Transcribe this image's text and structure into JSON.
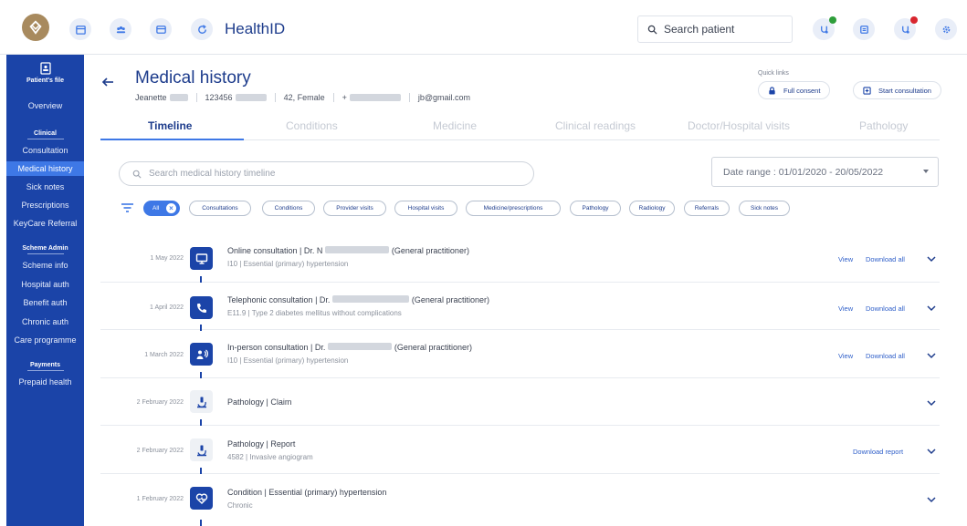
{
  "app": {
    "title": "HealthID"
  },
  "topbar": {
    "search_text": "Search patient"
  },
  "sidebar": {
    "file_label": "Patient's file",
    "overview": "Overview",
    "clinical_heading": "Clinical",
    "clinical_items": [
      "Consultation",
      "Medical history",
      "Sick notes",
      "Prescriptions",
      "KeyCare Referral"
    ],
    "scheme_heading": "Scheme Admin",
    "scheme_items": [
      "Scheme info",
      "Hospital auth",
      "Benefit auth",
      "Chronic auth",
      "Care programme"
    ],
    "payments_heading": "Payments",
    "payments_items": [
      "Prepaid health"
    ],
    "active_item": "Medical history"
  },
  "header": {
    "title": "Medical history",
    "patient_name": "Jeanette",
    "patient_id": "123456",
    "age_gender": "42, Female",
    "phone_prefix": "+",
    "email": "jb@gmail.com",
    "quick_links_label": "Quick links",
    "full_consent": "Full consent",
    "start_consultation": "Start consultation"
  },
  "tabs": [
    "Timeline",
    "Conditions",
    "Medicine",
    "Clinical readings",
    "Doctor/Hospital visits",
    "Pathology"
  ],
  "active_tab": "Timeline",
  "search": {
    "placeholder": "Search medical history timeline"
  },
  "date_range": "Date range : 01/01/2020 - 20/05/2022",
  "filters": [
    "All",
    "Consultations",
    "Conditions",
    "Provider visits",
    "Hospital visits",
    "Medicine/prescriptions",
    "Pathology",
    "Radiology",
    "Referrals",
    "Sick notes"
  ],
  "timeline": [
    {
      "date": "1 May 2022",
      "icon": "monitor-icon",
      "title": "Online consultation | Dr. N",
      "title_suffix": "(General practitioner)",
      "sub": "I10 | Essential (primary) hypertension",
      "links": [
        "View",
        "Download all"
      ]
    },
    {
      "date": "1 April 2022",
      "icon": "phone-icon",
      "title": "Telephonic consultation | Dr.",
      "title_suffix": "(General practitioner)",
      "sub": "E11.9 | Type 2 diabetes mellitus without complications",
      "links": [
        "View",
        "Download all"
      ]
    },
    {
      "date": "1 March 2022",
      "icon": "in-person-icon",
      "title": "In-person consultation | Dr.",
      "title_suffix": "(General practitioner)",
      "sub": "I10 | Essential (primary) hypertension",
      "links": [
        "View",
        "Download all"
      ]
    },
    {
      "date": "2 February 2022",
      "icon": "microscope-icon",
      "title": "Pathology | Claim",
      "title_suffix": "",
      "sub": "",
      "links": []
    },
    {
      "date": "2 February 2022",
      "icon": "microscope-icon",
      "title": "Pathology | Report",
      "title_suffix": "",
      "sub": "4582 | Invasive angiogram",
      "links": [
        "Download report"
      ]
    },
    {
      "date": "1 February 2022",
      "icon": "heart-icon",
      "title": "Condition | Essential (primary) hypertension",
      "title_suffix": "",
      "sub": "Chronic",
      "links": []
    }
  ],
  "colors": {
    "primary": "#1b44a8",
    "accent": "#3e78e6",
    "brand": "#a88a5e"
  }
}
